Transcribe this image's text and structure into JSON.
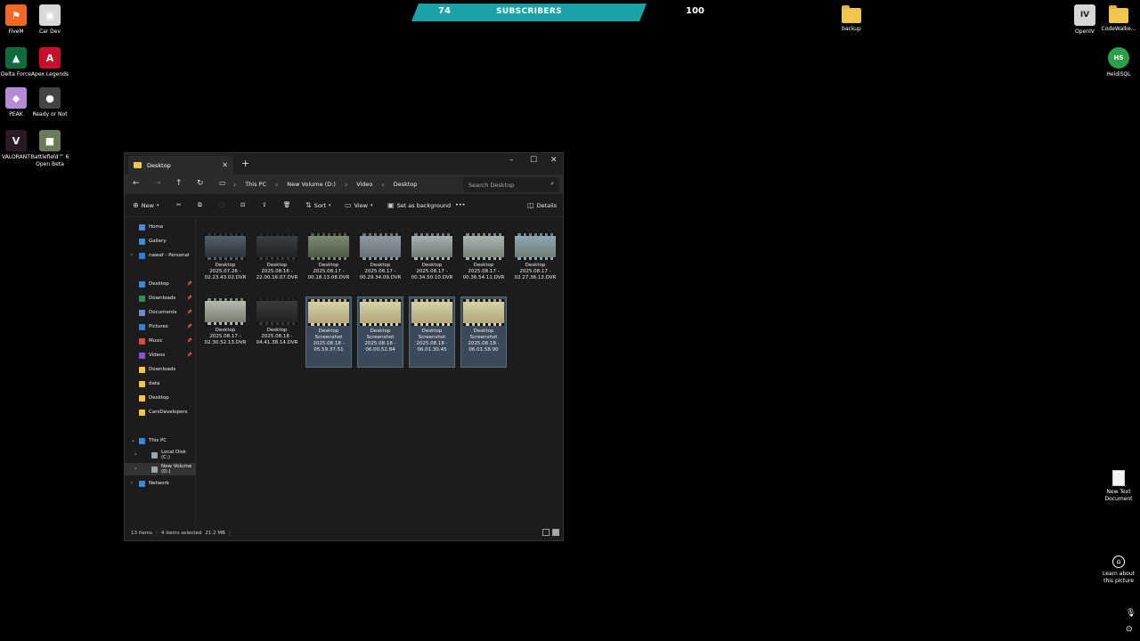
{
  "desktop": {
    "left_icons": [
      {
        "name": "fivem",
        "label": "FiveM",
        "glyph": "⚑",
        "color": "#f06a24"
      },
      {
        "name": "car-dev",
        "label": "Car Dev",
        "glyph": "▣",
        "color": "#d8d8d8"
      },
      {
        "name": "delta-force",
        "label": "Delta Force",
        "glyph": "▲",
        "color": "#0d6b3c"
      },
      {
        "name": "apex-legends",
        "label": "Apex Legends",
        "glyph": "A",
        "color": "#c8102e"
      },
      {
        "name": "peak",
        "label": "PEAK",
        "glyph": "◆",
        "color": "#b58ad6"
      },
      {
        "name": "ready-or-not",
        "label": "Ready or Not",
        "glyph": "●",
        "color": "#444444"
      },
      {
        "name": "valorant",
        "label": "VALORANT",
        "glyph": "V",
        "color": "#2a1a24"
      },
      {
        "name": "battlefield-6",
        "label": "Battlefield™ 6 Open Beta",
        "glyph": "■",
        "color": "#6c7a5c"
      }
    ],
    "right_icons": [
      {
        "name": "backup",
        "label": "backup"
      },
      {
        "name": "openiv",
        "label": "OpenIV",
        "glyph": "IV"
      },
      {
        "name": "codewalker",
        "label": "CodeWalke..."
      },
      {
        "name": "heidisql",
        "label": "HeidiSQL",
        "glyph": "HS"
      },
      {
        "name": "new-text-document",
        "label": "New Text Document"
      }
    ],
    "learn_label": "Learn about this picture"
  },
  "overlay": {
    "current": "74",
    "title": "SUBSCRIBERS",
    "goal": "100",
    "color": "#1ba1a8"
  },
  "explorer": {
    "tab_title": "Desktop",
    "breadcrumbs": [
      "This PC",
      "New Volume (D:)",
      "Video",
      "Desktop"
    ],
    "search_placeholder": "Search Desktop",
    "toolbar": {
      "new": "New",
      "sort": "Sort",
      "view": "View",
      "set_bg": "Set as background",
      "details": "Details"
    },
    "sidebar": [
      {
        "label": "Home",
        "color": "#4f8ad8"
      },
      {
        "label": "Gallery",
        "color": "#3a8fd6"
      },
      {
        "label": "nawaf - Personal",
        "color": "#2d7fd3"
      },
      {
        "label": "Desktop",
        "color": "#3b88d9",
        "pin": true
      },
      {
        "label": "Downloads",
        "color": "#2f8f5a",
        "pin": true
      },
      {
        "label": "Documents",
        "color": "#6b8fc8",
        "pin": true
      },
      {
        "label": "Pictures",
        "color": "#3b7fd0",
        "pin": true
      },
      {
        "label": "Music",
        "color": "#d84f3b",
        "pin": true
      },
      {
        "label": "Videos",
        "color": "#8d4fd8",
        "pin": true
      },
      {
        "label": "Downloads",
        "color": "#f2c64a"
      },
      {
        "label": "data",
        "color": "#f2c64a"
      },
      {
        "label": "Desktop",
        "color": "#f2c64a"
      },
      {
        "label": "CarsDevelopers",
        "color": "#f2c64a"
      },
      {
        "label": "This PC",
        "color": "#3b88d9"
      },
      {
        "label": "Local Disk (C:)",
        "color": "#9aa4ad"
      },
      {
        "label": "New Volume (D:)",
        "color": "#9aa4ad"
      },
      {
        "label": "Network",
        "color": "#3b88d9"
      }
    ],
    "files": [
      {
        "l1": "Desktop",
        "l2": "2025.07.26 -",
        "l3": "02.23.43.02.DVR",
        "c1": "#55606a",
        "c2": "#2c3238",
        "sel": false
      },
      {
        "l1": "Desktop",
        "l2": "2025.08.16 -",
        "l3": "22.00.16.07.DVR",
        "c1": "#3a3f44",
        "c2": "#1f2326",
        "sel": false
      },
      {
        "l1": "Desktop",
        "l2": "2025.08.17 -",
        "l3": "00.18.13.08.DVR",
        "c1": "#7d8a70",
        "c2": "#4d5a48",
        "sel": false
      },
      {
        "l1": "Desktop",
        "l2": "2025.08.17 -",
        "l3": "00.29.34.09.DVR",
        "c1": "#8f9aa0",
        "c2": "#6a7278",
        "sel": false
      },
      {
        "l1": "Desktop",
        "l2": "2025.08.17 -",
        "l3": "00.34.50.10.DVR",
        "c1": "#a8b0b4",
        "c2": "#6e7a70",
        "sel": false
      },
      {
        "l1": "Desktop",
        "l2": "2025.08.17 -",
        "l3": "00.36.54.11.DVR",
        "c1": "#aab2b6",
        "c2": "#7a8470",
        "sel": false
      },
      {
        "l1": "Desktop",
        "l2": "2025.08.17 -",
        "l3": "02.27.36.12.DVR",
        "c1": "#8fa6b8",
        "c2": "#6e8070",
        "sel": false
      },
      {
        "l1": "Desktop",
        "l2": "2025.08.17 -",
        "l3": "02.30.52.13.DVR",
        "c1": "#b4b8b0",
        "c2": "#7a8070",
        "sel": false
      },
      {
        "l1": "Desktop",
        "l2": "2025.08.18 -",
        "l3": "04.41.38.14.DVR",
        "c1": "#3a3c3a",
        "c2": "#222422",
        "sel": false
      },
      {
        "l1": "Desktop",
        "l2": "Screenshot",
        "l3": "2025.08.18 -",
        "l4": "05.59.37.51",
        "c1": "#d8d0a8",
        "c2": "#b0a878",
        "sel": true
      },
      {
        "l1": "Desktop",
        "l2": "Screenshot",
        "l3": "2025.08.18 -",
        "l4": "06.00.52.84",
        "c1": "#d8d0a8",
        "c2": "#b0a878",
        "sel": true
      },
      {
        "l1": "Desktop",
        "l2": "Screenshot",
        "l3": "2025.08.18 -",
        "l4": "06.01.30.45",
        "c1": "#d8d0a8",
        "c2": "#b0a878",
        "sel": true
      },
      {
        "l1": "Desktop",
        "l2": "Screenshot",
        "l3": "2025.08.18 -",
        "l4": "06.01.58.90",
        "c1": "#d8d0a8",
        "c2": "#b0a878",
        "sel": true
      }
    ],
    "status": {
      "items": "13 items",
      "selected": "4 items selected",
      "size": "21.2 MB"
    }
  }
}
